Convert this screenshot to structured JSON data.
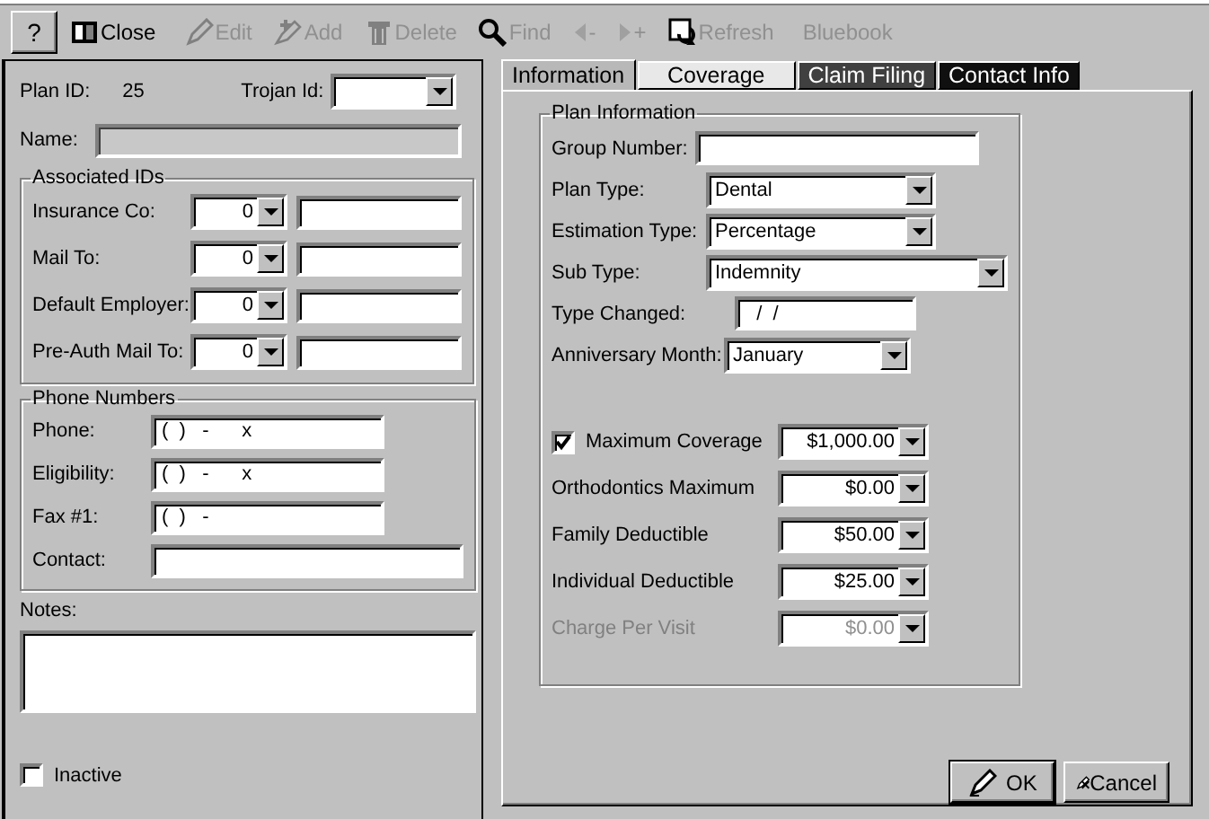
{
  "toolbar": [
    {
      "kind": "help",
      "label": "?"
    },
    {
      "kind": "close",
      "label": "Close",
      "disabled": false
    },
    {
      "kind": "edit",
      "label": "Edit",
      "disabled": true
    },
    {
      "kind": "add",
      "label": "Add",
      "disabled": true
    },
    {
      "kind": "delete",
      "label": "Delete",
      "disabled": true
    },
    {
      "kind": "find",
      "label": "Find",
      "disabled": true
    },
    {
      "kind": "prev",
      "label": "-",
      "disabled": true
    },
    {
      "kind": "next",
      "label": "+",
      "disabled": true
    },
    {
      "kind": "refresh",
      "label": "Refresh",
      "disabled": true
    },
    {
      "kind": "bluebook",
      "label": "Bluebook",
      "disabled": true
    }
  ],
  "plan": {
    "plan_id_label": "Plan ID:",
    "plan_id": "25",
    "trojan_label": "Trojan Id:",
    "name_label": "Name:",
    "name_disabled": true
  },
  "associated_ids": {
    "title": "Associated IDs",
    "rows": [
      {
        "label": "Insurance Co:",
        "id": "0"
      },
      {
        "label": "Mail To:",
        "id": "0"
      },
      {
        "label": "Default Employer:",
        "id": "0"
      },
      {
        "label": "Pre-Auth Mail To:",
        "id": "0"
      }
    ]
  },
  "phone_numbers": {
    "title": "Phone Numbers",
    "rows": [
      {
        "label": "Phone:",
        "value": "(  )   -      x"
      },
      {
        "label": "Eligibility:",
        "value": "(  )   -      x"
      },
      {
        "label": "Fax #1:",
        "value": "(  )   -"
      },
      {
        "label": "Contact:"
      }
    ]
  },
  "notes": {
    "label": "Notes:"
  },
  "inactive": {
    "label": "Inactive",
    "checked": false
  },
  "tabs": [
    {
      "label": "Information",
      "selected": true,
      "color": "#b8b8b8"
    },
    {
      "label": "Coverage",
      "selected": false,
      "color": "#e8e8e8"
    },
    {
      "label": "Claim Filing",
      "selected": false,
      "color": "#404040"
    },
    {
      "label": "Contact Info",
      "selected": false,
      "color": "#101010"
    }
  ],
  "plan_information": {
    "title": "Plan Information",
    "fields": [
      {
        "kind": "text",
        "label": "Group Number:"
      },
      {
        "kind": "select",
        "label": "Plan Type:",
        "value": "Dental"
      },
      {
        "kind": "select",
        "label": "Estimation Type:",
        "value": "Percentage"
      },
      {
        "kind": "select",
        "label": "Sub Type:",
        "value": "Indemnity"
      },
      {
        "kind": "text",
        "label": "Type Changed:",
        "value": "  /  /"
      },
      {
        "kind": "select",
        "label": "Anniversary Month:",
        "value": "January"
      }
    ]
  },
  "amounts": [
    {
      "kind": "checkbox",
      "label": "Maximum Coverage",
      "value": "$1,000.00",
      "checked": true,
      "disabled": false
    },
    {
      "kind": "plain",
      "label": "Orthodontics Maximum",
      "value": "$0.00",
      "disabled": false
    },
    {
      "kind": "plain",
      "label": "Family Deductible",
      "value": "$50.00",
      "disabled": false
    },
    {
      "kind": "plain",
      "label": "Individual Deductible",
      "value": "$25.00",
      "disabled": false
    },
    {
      "kind": "plain",
      "label": "Charge Per Visit",
      "value": "$0.00",
      "disabled": true
    }
  ],
  "buttons": [
    {
      "kind": "ok",
      "label": "OK"
    },
    {
      "kind": "cancel",
      "label": "Cancel"
    }
  ]
}
